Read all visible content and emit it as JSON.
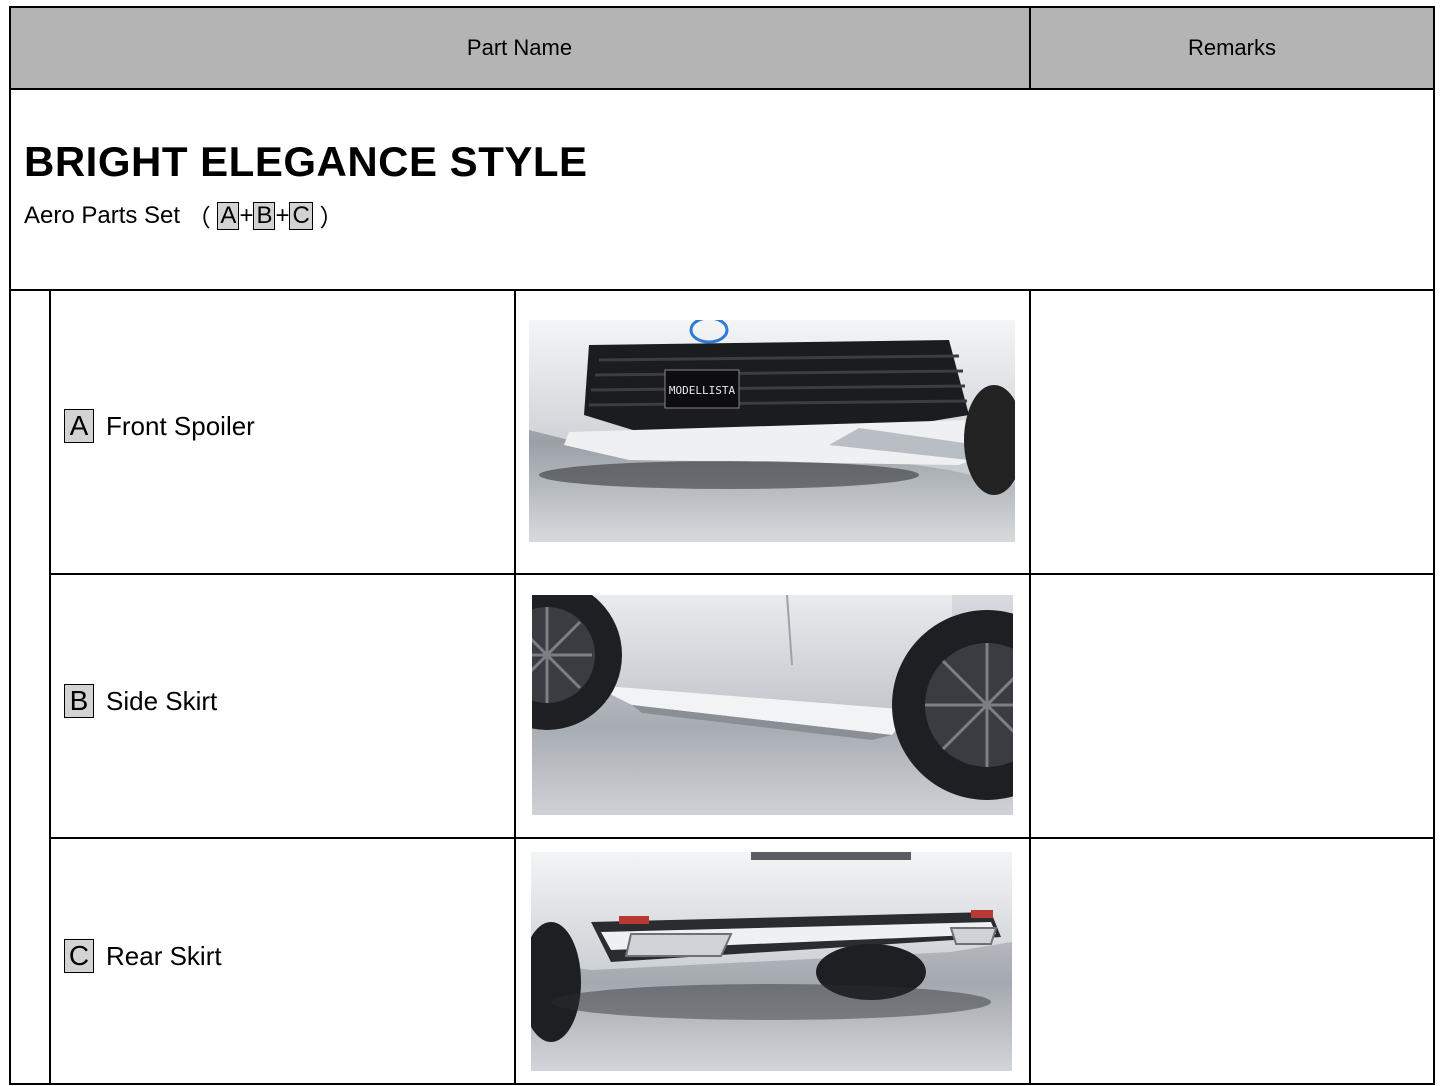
{
  "table": {
    "header": {
      "part_name": "Part Name",
      "remarks": "Remarks"
    },
    "section": {
      "title": "BRIGHT ELEGANCE STYLE",
      "set_label": "Aero Parts Set",
      "open_paren": "（",
      "close_paren": "）",
      "plus": "+",
      "keys": [
        "A",
        "B",
        "C"
      ]
    },
    "rows": [
      {
        "key": "A",
        "name": "Front Spoiler",
        "image": "front-spoiler-photo",
        "plate_text": "MODELLISTA",
        "remarks": ""
      },
      {
        "key": "B",
        "name": "Side Skirt",
        "image": "side-skirt-photo",
        "remarks": ""
      },
      {
        "key": "C",
        "name": "Rear Skirt",
        "image": "rear-skirt-photo",
        "remarks": ""
      }
    ]
  }
}
